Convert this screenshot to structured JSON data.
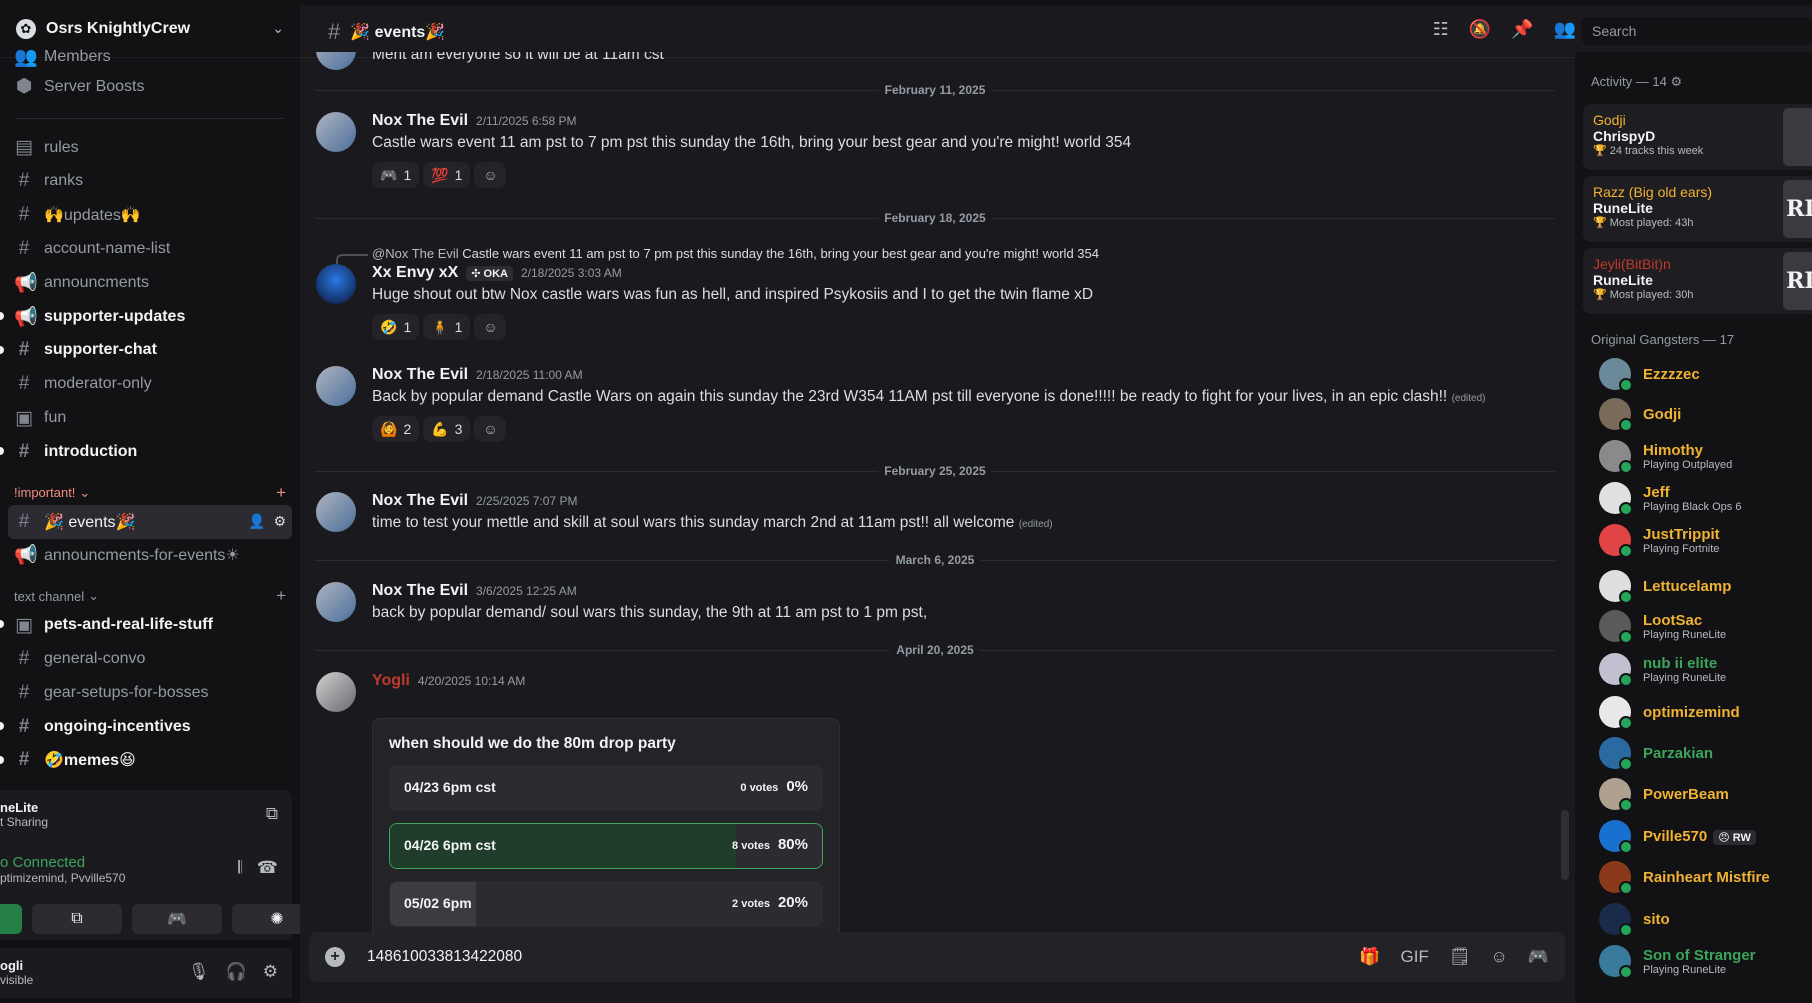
{
  "sidebar": {
    "server_name": "Osrs KnightlyCrew",
    "top_items": [
      {
        "icon": "members-icon",
        "label": "Members"
      },
      {
        "icon": "boost-icon",
        "label": "Server Boosts"
      }
    ],
    "channels": [
      {
        "label": "rules"
      },
      {
        "label": "ranks"
      },
      {
        "label": "🙌updates🙌"
      },
      {
        "label": "account-name-list"
      },
      {
        "label": "announcments"
      },
      {
        "label": "supporter-updates"
      },
      {
        "label": "supporter-chat"
      },
      {
        "label": "moderator-only"
      },
      {
        "label": "fun"
      },
      {
        "label": "introduction"
      }
    ],
    "category_important": "!important!",
    "events_channel": "🎉 events🎉",
    "announcements_events": "announcments-for-events☀",
    "category_text": "text channel",
    "text_channels": [
      {
        "label": "pets-and-real-life-stuff"
      },
      {
        "label": "general-convo"
      },
      {
        "label": "gear-setups-for-bosses"
      },
      {
        "label": "ongoing-incentives"
      },
      {
        "label": "🤣memes😆"
      }
    ]
  },
  "activity_panel": {
    "title": "neLite",
    "sub": "t Sharing"
  },
  "voice_panel": {
    "status": "o Connected",
    "users": "ptimizemind, Pvville570"
  },
  "user_panel": {
    "name": "ogli",
    "status": "visible"
  },
  "header": {
    "channel": "🎉 events🎉",
    "search_placeholder": "Search"
  },
  "chat": {
    "top_fragment": "Ment am everyone so it will be at 11am cst",
    "dates": [
      "February 11, 2025",
      "February 18, 2025",
      "February 25, 2025",
      "March 6, 2025",
      "April 20, 2025"
    ],
    "messages": [
      {
        "author": "Nox The Evil",
        "time": "2/11/2025 6:58 PM",
        "text": "Castle wars event 11 am pst to 7 pm pst this sunday the 16th, bring your best gear and you're might! world 354",
        "reactions": [
          {
            "emoji": "🎮",
            "count": "1"
          },
          {
            "emoji": "💯",
            "count": "1"
          }
        ]
      },
      {
        "reply_author": "@Nox The Evil",
        "reply_text": "Castle wars event 11 am pst to 7 pm pst this sunday the 16th, bring your best gear and you're might! world 354",
        "author": "Xx Envy xX",
        "tag": "✣ OKA",
        "time": "2/18/2025 3:03 AM",
        "text": "Huge shout out btw Nox castle wars was fun as hell, and inspired Psykosiis and I to get the twin flame xD",
        "reactions": [
          {
            "emoji": "🤣",
            "count": "1"
          },
          {
            "emoji": "🧍",
            "count": "1"
          }
        ]
      },
      {
        "author": "Nox The Evil",
        "time": "2/18/2025 11:00 AM",
        "text": "Back by popular demand Castle Wars on again this sunday the 23rd W354 11AM pst till everyone is done!!!!! be ready to fight for your lives, in an epic clash!!",
        "edited": "(edited)",
        "reactions": [
          {
            "emoji": "🙆",
            "count": "2"
          },
          {
            "emoji": "💪",
            "count": "3"
          }
        ]
      },
      {
        "author": "Nox The Evil",
        "time": "2/25/2025 7:07 PM",
        "text": "time to test your mettle and skill at soul wars this sunday march 2nd at 11am pst!! all welcome",
        "edited": "(edited)"
      },
      {
        "author": "Nox The Evil",
        "time": "3/6/2025 12:25 AM",
        "text": "back by popular demand/ soul wars this sunday, the 9th  at 11 am pst to 1 pm pst,"
      },
      {
        "author": "Yogli",
        "time": "4/20/2025 10:14 AM"
      }
    ],
    "poll": {
      "question": "when should we do the 80m drop party",
      "options": [
        {
          "label": "04/23 6pm cst",
          "votes": "0 votes",
          "percent": "0%",
          "fraction": 0.0
        },
        {
          "label": "04/26 6pm cst",
          "votes": "8 votes",
          "percent": "80%",
          "fraction": 0.8
        },
        {
          "label": "05/02 6pm",
          "votes": "2 votes",
          "percent": "20%",
          "fraction": 0.2
        }
      ]
    }
  },
  "composer": {
    "value": "1486100338134220​80"
  },
  "members": {
    "activity_title": "Activity — 14",
    "activities": [
      {
        "who": "Godji",
        "what": "ChrispyD",
        "stat": "24 tracks this week",
        "thumb": ""
      },
      {
        "who": "Razz (Big old ears)",
        "what": "RuneLite",
        "stat": "Most played: 43h",
        "thumb": "RL"
      },
      {
        "who": "Jeyli(BitBit)n",
        "what": "RuneLite",
        "stat": "Most played: 30h",
        "thumb": "RL"
      }
    ],
    "group_title": "Original Gangsters — 17",
    "list": [
      {
        "name": "Ezzzzec",
        "activity": ""
      },
      {
        "name": "Godji",
        "activity": ""
      },
      {
        "name": "Himothy",
        "activity": "Playing Outplayed"
      },
      {
        "name": "Jeff",
        "activity": "Playing Black Ops 6"
      },
      {
        "name": "JustTrippit",
        "activity": "Playing Fortnite"
      },
      {
        "name": "Lettucelamp",
        "activity": ""
      },
      {
        "name": "LootSac",
        "activity": "Playing RuneLite"
      },
      {
        "name": "nub ii elite",
        "activity": "Playing RuneLite"
      },
      {
        "name": "optimizemind",
        "activity": ""
      },
      {
        "name": "Parzakian",
        "activity": ""
      },
      {
        "name": "PowerBeam",
        "activity": ""
      },
      {
        "name": "Pville570",
        "activity": "",
        "tag": "😠 RW"
      },
      {
        "name": "Rainheart Mistfire",
        "activity": ""
      },
      {
        "name": "sito",
        "activity": ""
      },
      {
        "name": "Son of Stranger",
        "activity": "Playing RuneLite"
      }
    ]
  }
}
